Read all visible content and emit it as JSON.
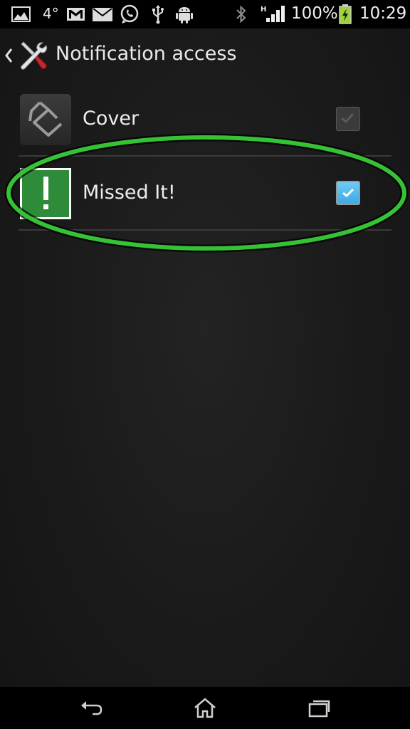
{
  "status_bar": {
    "temperature": "4°",
    "battery_percent": "100%",
    "time": "10:29",
    "network_type": "H",
    "icons": [
      "gallery-icon",
      "weather-icon",
      "gmail-icon",
      "email-icon",
      "whatsapp-icon",
      "usb-icon",
      "android-debug-icon",
      "bluetooth-icon",
      "signal-icon",
      "battery-charging-icon"
    ]
  },
  "action_bar": {
    "title": "Notification access",
    "icons": [
      "up-arrow-icon",
      "settings-tools-icon"
    ]
  },
  "list": {
    "items": [
      {
        "label": "Cover",
        "icon": "cover-app-icon",
        "checked": true,
        "enabled": false
      },
      {
        "label": "Missed It!",
        "icon": "missed-it-app-icon",
        "checked": true,
        "enabled": true
      }
    ]
  },
  "annotation": {
    "shape": "ellipse",
    "color": "#35c235",
    "target": "Missed It!"
  },
  "nav_bar": {
    "buttons": [
      "back-icon",
      "home-icon",
      "recent-apps-icon"
    ]
  },
  "colors": {
    "background": "#1a1a1a",
    "status_bar": "#000000",
    "checkbox_checked": "#4db8ec",
    "divider": "#3a3a3a",
    "missed_it_icon": "#2e8b3a"
  }
}
